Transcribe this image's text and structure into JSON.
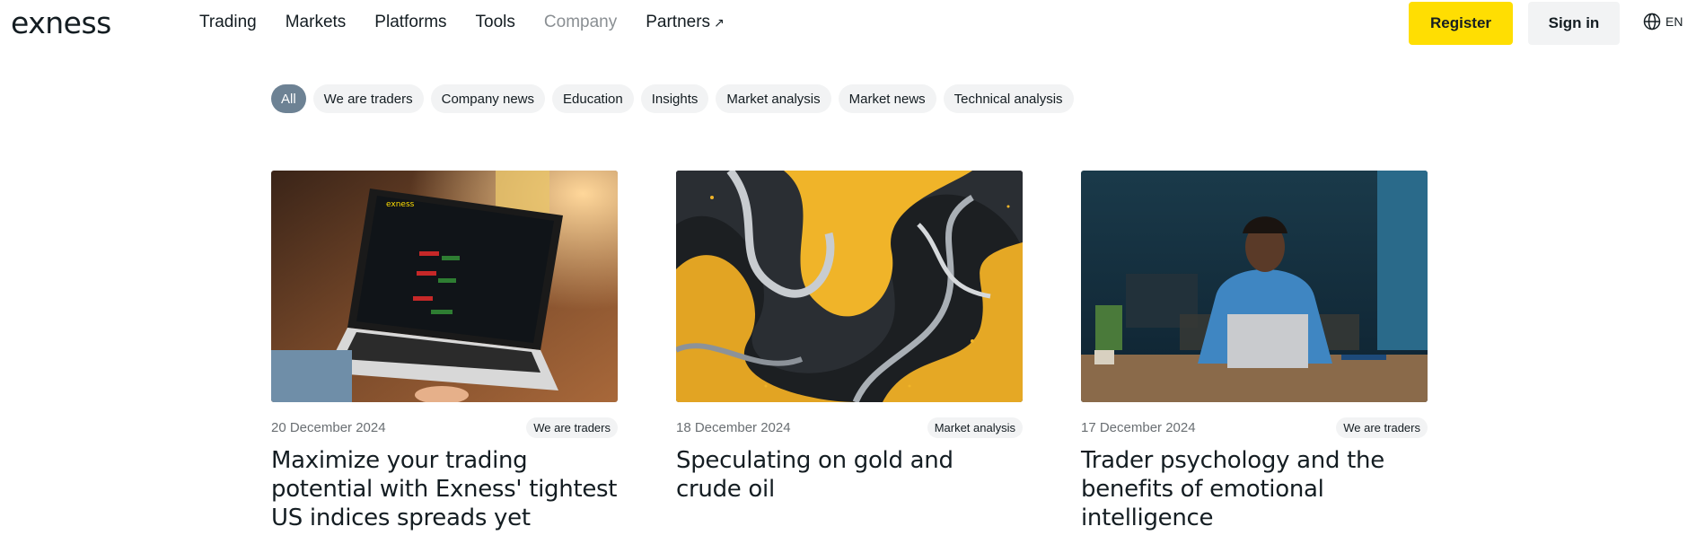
{
  "header": {
    "logo": "exness",
    "nav": [
      {
        "label": "Trading"
      },
      {
        "label": "Markets"
      },
      {
        "label": "Platforms"
      },
      {
        "label": "Tools"
      },
      {
        "label": "Company"
      },
      {
        "label": "Partners"
      }
    ],
    "register_label": "Register",
    "signin_label": "Sign in",
    "language": "EN"
  },
  "filters": [
    "All",
    "We are traders",
    "Company news",
    "Education",
    "Insights",
    "Market analysis",
    "Market news",
    "Technical analysis"
  ],
  "articles": [
    {
      "date": "20 December 2024",
      "tag": "We are traders",
      "title": "Maximize your trading potential with Exness' tightest US indices spreads yet",
      "image": "laptop-trading-platform"
    },
    {
      "date": "18 December 2024",
      "tag": "Market analysis",
      "title": "Speculating on gold and crude oil",
      "image": "gold-black-marble-swirl"
    },
    {
      "date": "17 December 2024",
      "tag": "We are traders",
      "title": "Trader psychology and the benefits of emotional intelligence",
      "image": "man-at-laptop-office"
    }
  ],
  "colors": {
    "accent": "#ffde02",
    "active_chip": "#6d8294",
    "chip_bg": "#f2f3f4",
    "text": "#141d22"
  }
}
